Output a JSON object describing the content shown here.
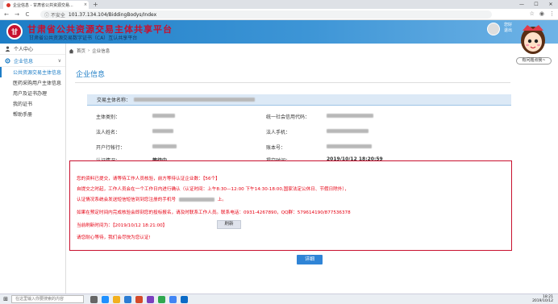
{
  "browser": {
    "tab_title": "企业信息 - 甘肃省公共资源交易...",
    "tab_close": "×",
    "new_tab": "+",
    "win_min": "—",
    "win_max": "☐",
    "win_close": "✕",
    "nav_back": "←",
    "nav_fwd": "→",
    "nav_reload": "C",
    "security": "ⓘ 不安全",
    "url": "101.37.134.104/BiddingBodys/Index",
    "star": "☆",
    "account": "◉",
    "menu": "⋮"
  },
  "header": {
    "logo_text": "甘",
    "site_title": "甘肃省公共资源交易主体共享平台",
    "site_subtitle": "甘肃省公共资源交易数字证书（CA）互认共享平台",
    "user_greeting": "您好",
    "user_action": "退出"
  },
  "help_button": "有问题点我~",
  "sidebar": {
    "personal_center": "个人中心",
    "enterprise_section": "企业信息",
    "chevron": "∨",
    "items": [
      {
        "label": "公共资源交易主体信息"
      },
      {
        "label": "医药采购用户主体信息"
      },
      {
        "label": "用户及证书办理"
      },
      {
        "label": "我的证书"
      },
      {
        "label": "帮助手册"
      }
    ]
  },
  "breadcrumb": {
    "home": "首页",
    "separator": "›",
    "current": "企业信息"
  },
  "panel": {
    "title": "企业信息",
    "subject_label": "交易主体名称：",
    "fields": {
      "type_label": "主体类别：",
      "credit_code_label": "统一社会信用代码：",
      "legal_rep_label": "法人姓名：",
      "legal_phone_label": "法人手机：",
      "bank_label": "开户行帐行：",
      "account_label": "账本号：",
      "cert_status_label": "认证情况：",
      "cert_status_value": "等待中",
      "submit_time_label": "提交时间：",
      "submit_time_value": "2019/10/12 18:20:59"
    }
  },
  "modal": {
    "line1": "您的资料已提交，请等待工作人员核验，前方等待认证企业数：【56个】",
    "line2": "自提交之时起，工作人员会在一个工作日内进行确认（认证时间：上午8:30—12:00 下午14:30-18:00,国家法定公休日、节假日除外），",
    "line3": "认证情况系统会发送短信短信到到您注册的手机号",
    "line3_tail": "上。",
    "line4": "如果在预定时间内完成核验会即刻您的投标报名，请及时联系工作人员。联系电话：0931-4267890，QQ群：579614190/877536378",
    "line5_label": "当前刷新时间为：【2019/10/12 18:21:00】",
    "refresh": "刷新",
    "line6": "请您耐心等待，我们会尽快为您认证!"
  },
  "detail_button": "详细",
  "taskbar": {
    "start": "⊞",
    "search_placeholder": "在这里输入你要搜索的内容",
    "time": "18:21",
    "date": "2019/10/12"
  },
  "colors": {
    "brand_blue": "#1d7dc6",
    "alert_red": "#e60012",
    "title_red": "#c8102e"
  }
}
